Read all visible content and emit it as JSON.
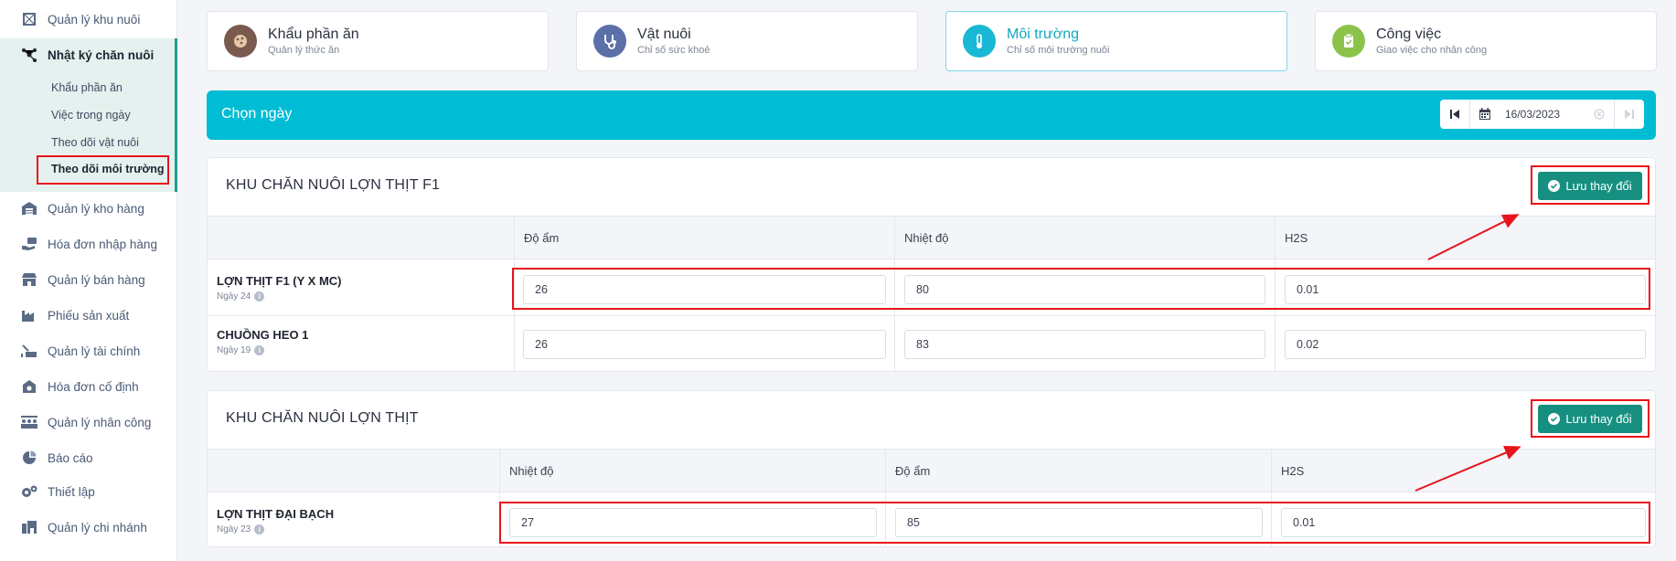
{
  "sidebar": {
    "items": [
      {
        "label": "Quản lý khu nuôi",
        "icon": "barn-frame-icon"
      },
      {
        "label": "Nhật ký chăn nuôi",
        "icon": "network-icon"
      },
      {
        "label": "Quản lý kho hàng",
        "icon": "warehouse-icon"
      },
      {
        "label": "Hóa đơn nhập hàng",
        "icon": "hand-money-icon"
      },
      {
        "label": "Quản lý bán hàng",
        "icon": "store-icon"
      },
      {
        "label": "Phiếu sản xuất",
        "icon": "factory-icon"
      },
      {
        "label": "Quản lý tài chính",
        "icon": "finance-icon"
      },
      {
        "label": "Hóa đơn cố định",
        "icon": "money-box-icon"
      },
      {
        "label": "Quản lý nhân công",
        "icon": "workers-icon"
      },
      {
        "label": "Báo cáo",
        "icon": "pie-chart-icon"
      },
      {
        "label": "Thiết lập",
        "icon": "gears-icon"
      },
      {
        "label": "Quản lý chi nhánh",
        "icon": "branch-icon"
      }
    ],
    "subitems": [
      "Khẩu phần ăn",
      "Việc trong ngày",
      "Theo dõi vật nuôi",
      "Theo dõi môi trường"
    ]
  },
  "cards": [
    {
      "title": "Khẩu phần ăn",
      "subtitle": "Quản lý thức ăn",
      "color": "#7a5a4e"
    },
    {
      "title": "Vật nuôi",
      "subtitle": "Chỉ số sức khoẻ",
      "color": "#5b6fa8"
    },
    {
      "title": "Môi trường",
      "subtitle": "Chỉ số môi trường nuôi",
      "color": "#19b8d4"
    },
    {
      "title": "Công việc",
      "subtitle": "Giao việc cho nhân công",
      "color": "#8bc34a"
    }
  ],
  "datebar": {
    "label": "Chọn ngày",
    "date": "16/03/2023"
  },
  "panels": [
    {
      "title": "KHU CHĂN NUÔI LỢN THỊT F1",
      "save_label": "Lưu thay đổi",
      "columns": [
        "Độ ẩm",
        "Nhiệt độ",
        "H2S"
      ],
      "rows": [
        {
          "name": "LỢN THỊT F1 (Y X MC)",
          "day": "Ngày 24",
          "values": [
            "26",
            "80",
            "0.01"
          ]
        },
        {
          "name": "CHUỒNG HEO 1",
          "day": "Ngày 19",
          "values": [
            "26",
            "83",
            "0.02"
          ]
        }
      ]
    },
    {
      "title": "KHU CHĂN NUÔI LỢN THỊT",
      "save_label": "Lưu thay đổi",
      "columns": [
        "Nhiệt độ",
        "Độ ẩm",
        "H2S"
      ],
      "rows": [
        {
          "name": "LỢN THỊT ĐẠI BẠCH",
          "day": "Ngày 23",
          "values": [
            "27",
            "85",
            "0.01"
          ]
        }
      ]
    }
  ],
  "colors": {
    "accent": "#00bcd4",
    "save": "#168f80",
    "highlight": "#e8141b"
  }
}
